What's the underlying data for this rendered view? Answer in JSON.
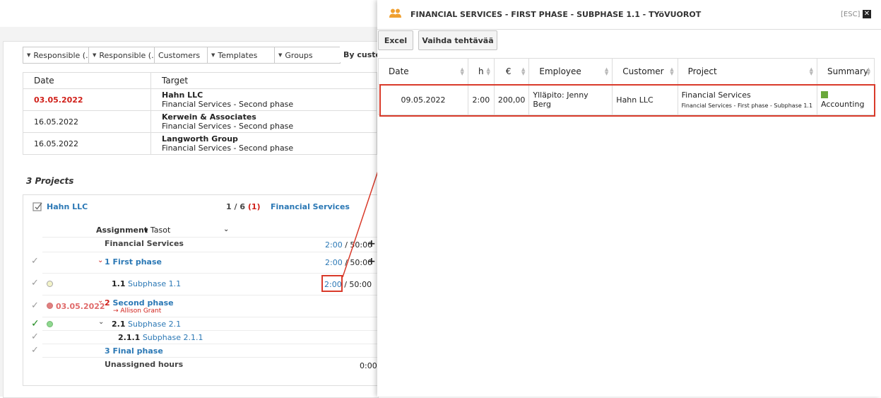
{
  "background": {
    "filters": [
      "Responsible (...",
      "Responsible (...",
      "Customers",
      "Templates",
      "Groups",
      "By custom"
    ],
    "target_table": {
      "headers": [
        "Date",
        "Target"
      ],
      "rows": [
        {
          "date": "03.05.2022",
          "customer": "Hahn LLC",
          "project": "Financial Services - Second phase",
          "overdue": true
        },
        {
          "date": "16.05.2022",
          "customer": "Kerwein & Associates",
          "project": "Financial Services - Second phase",
          "overdue": false
        },
        {
          "date": "16.05.2022",
          "customer": "Langworth Group",
          "project": "Financial Services - Second phase",
          "overdue": false
        }
      ]
    },
    "projects_heading": "3 Projects",
    "project": {
      "customer": "Hahn LLC",
      "progress": "1 / 6",
      "progress_count": "(1)",
      "project_name": "Financial Services",
      "assignment_label": "Assignment",
      "tasot_label": "Tasot",
      "rows": {
        "root": {
          "label": "Financial Services",
          "done": "2:00",
          "total": "/ 50:00"
        },
        "first_phase": {
          "num": "1",
          "label": "First phase",
          "done": "2:00",
          "total": "/ 50:00"
        },
        "subphase_11": {
          "num": "1.1",
          "label": "Subphase 1.1",
          "done": "2:00",
          "total": "/ 50:00"
        },
        "second_phase": {
          "date": "03.05.2022",
          "num": "2",
          "label": "Second phase",
          "assignee": "→ Allison Grant"
        },
        "subphase_21": {
          "num": "2.1",
          "label": "Subphase 2.1"
        },
        "subphase_211": {
          "num": "2.1.1",
          "label": "Subphase 2.1.1"
        },
        "final_phase": {
          "num": "3",
          "label": "Final phase"
        },
        "unassigned": {
          "label": "Unassigned hours",
          "value": "0:00"
        }
      }
    }
  },
  "panel": {
    "title": "FINANCIAL SERVICES - FIRST PHASE - SUBPHASE 1.1 - TYöVUOROT",
    "esc": "[ESC]",
    "buttons": {
      "excel": "Excel",
      "change_task": "Vaihda tehtävää"
    },
    "table": {
      "headers": [
        "Date",
        "h",
        "€",
        "Employee",
        "Customer",
        "Project",
        "Summary"
      ],
      "rows": [
        {
          "date": "09.05.2022",
          "hours": "2:00",
          "euros": "200,00",
          "employee": "Ylläpito: Jenny Berg",
          "customer": "Hahn LLC",
          "project": "Financial Services",
          "project_path": "Financial Services - First phase - Subphase 1.1",
          "summary": "Accounting",
          "summary_color": "#6aa83a"
        }
      ]
    }
  },
  "colors": {
    "link": "#2b78b5",
    "overdue": "#d0201a",
    "highlight": "#d93a2a",
    "accent_icon": "#f0a030"
  }
}
